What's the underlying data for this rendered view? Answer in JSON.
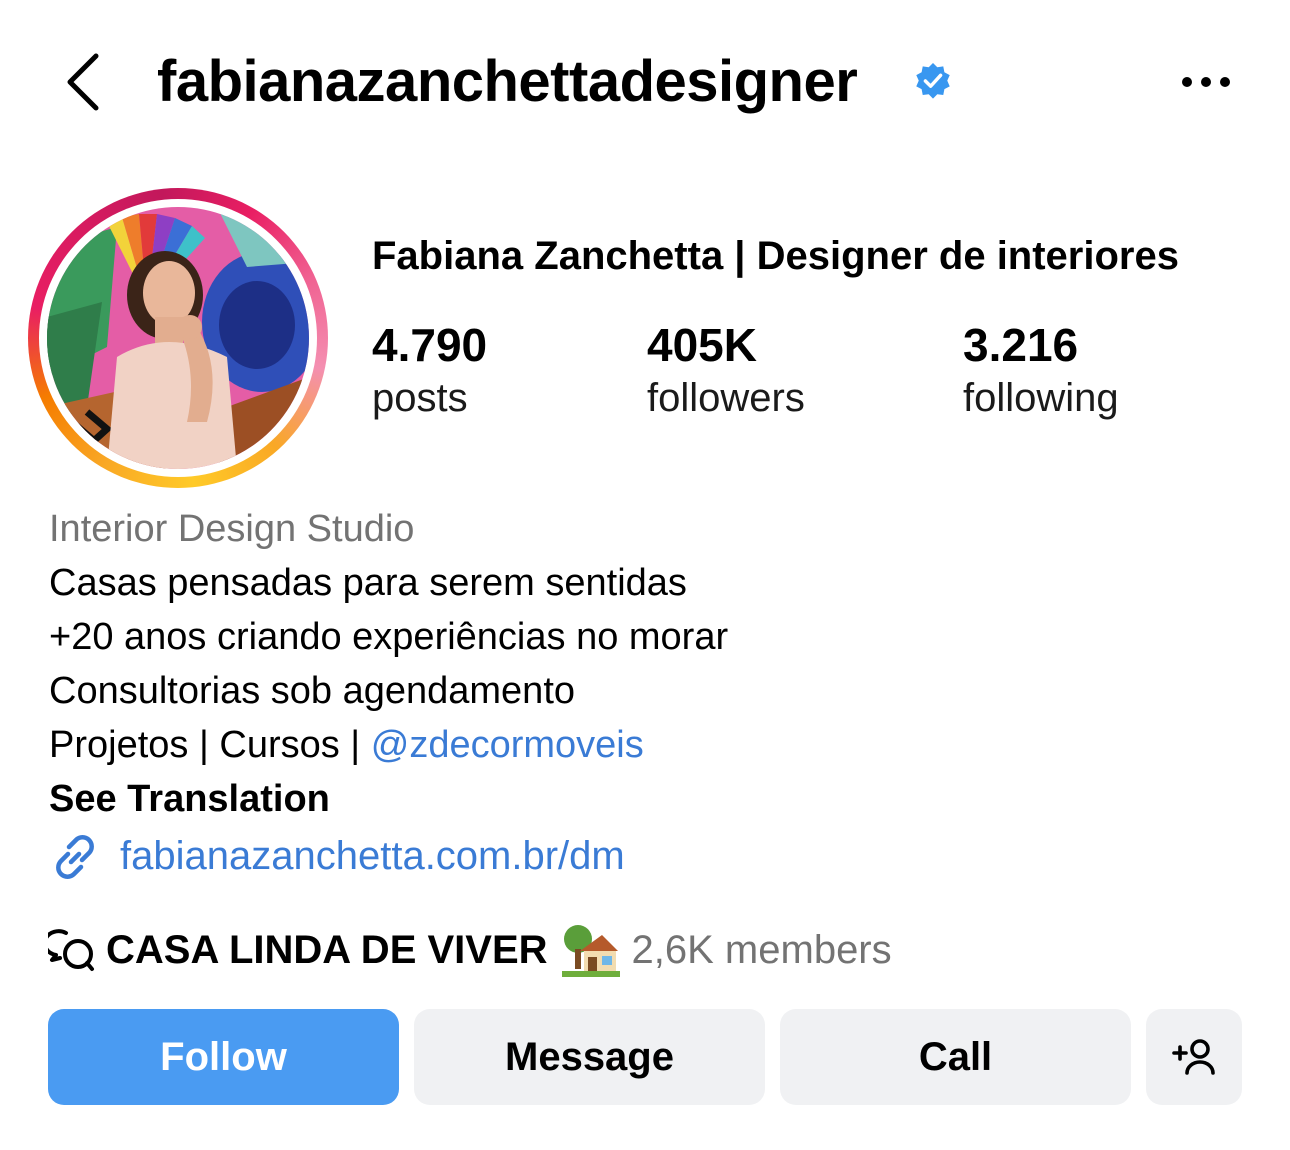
{
  "header": {
    "username": "fabianazanchettadesigner",
    "verified": true,
    "back_icon": "chevron-left-icon",
    "more_icon": "more-horizontal-icon"
  },
  "profile": {
    "full_name": "Fabiana Zanchetta | Designer de interiores",
    "stats": {
      "posts": {
        "value": "4.790",
        "label": "posts"
      },
      "followers": {
        "value": "405K",
        "label": "followers"
      },
      "following": {
        "value": "3.216",
        "label": "following"
      }
    }
  },
  "bio": {
    "category": "Interior Design Studio",
    "line1": "Casas pensadas para serem sentidas",
    "line2": "+20 anos criando experiências no morar",
    "line3": "Consultorias sob agendamento",
    "line4_prefix": "Projetos | Cursos | ",
    "mention": "@zdecormoveis",
    "see_translation": "See Translation",
    "link": "fabianazanchetta.com.br/dm"
  },
  "channel": {
    "icon": "chat-bubbles-icon",
    "name": "CASA LINDA DE VIVER",
    "emoji": "house-with-garden-emoji",
    "members": "2,6K members"
  },
  "actions": {
    "follow": "Follow",
    "message": "Message",
    "call": "Call",
    "add_icon": "add-person-icon"
  },
  "colors": {
    "accent_blue": "#4a9bf2",
    "link_blue": "#3a7bd5",
    "muted_gray": "#737373",
    "button_gray": "#f0f1f3",
    "verified_blue": "#3897f0"
  }
}
